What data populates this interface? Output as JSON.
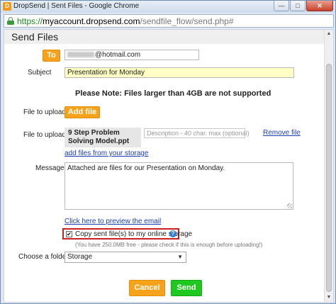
{
  "window": {
    "title": "DropSend | Sent Files - Google Chrome",
    "app_icon_letter": "D"
  },
  "address_bar": {
    "scheme": "https://",
    "host": "myaccount.dropsend.com",
    "path": "/sendfile_flow/send.php#"
  },
  "page": {
    "title": "Send Files",
    "to_button": "To",
    "to_value": "@hotmail.com",
    "subject_label": "Subject",
    "subject_value": "Presentation for Monday",
    "note": "Please Note: Files larger than 4GB are not supported",
    "file_to_upload_label_1": "File to upload",
    "add_file_button": "Add file",
    "file_to_upload_label_2": "File to upload",
    "file_name": "9 Step Problem Solving Model.ppt",
    "description_placeholder": "Description - 40 char. max (optional)",
    "remove_file_link": "Remove file",
    "add_files_link": "add files from your storage",
    "message_label": "Message",
    "message_value": "Attached are files for our Presentation on Monday.",
    "preview_link": "Click here to preview the email",
    "copy_label": "Copy sent file(s) to my online storage",
    "copy_checked": true,
    "storage_note": "(You have 250.0MB free - please check if this is enough before uploading!)",
    "folder_label": "Choose a folder",
    "folder_value": "Storage",
    "cancel_button": "Cancel",
    "send_button": "Send"
  },
  "colors": {
    "accent_orange": "#f6a21a",
    "send_green": "#1fc81f",
    "highlight_red": "#cc1f1f",
    "link_blue": "#1a3fb7"
  }
}
